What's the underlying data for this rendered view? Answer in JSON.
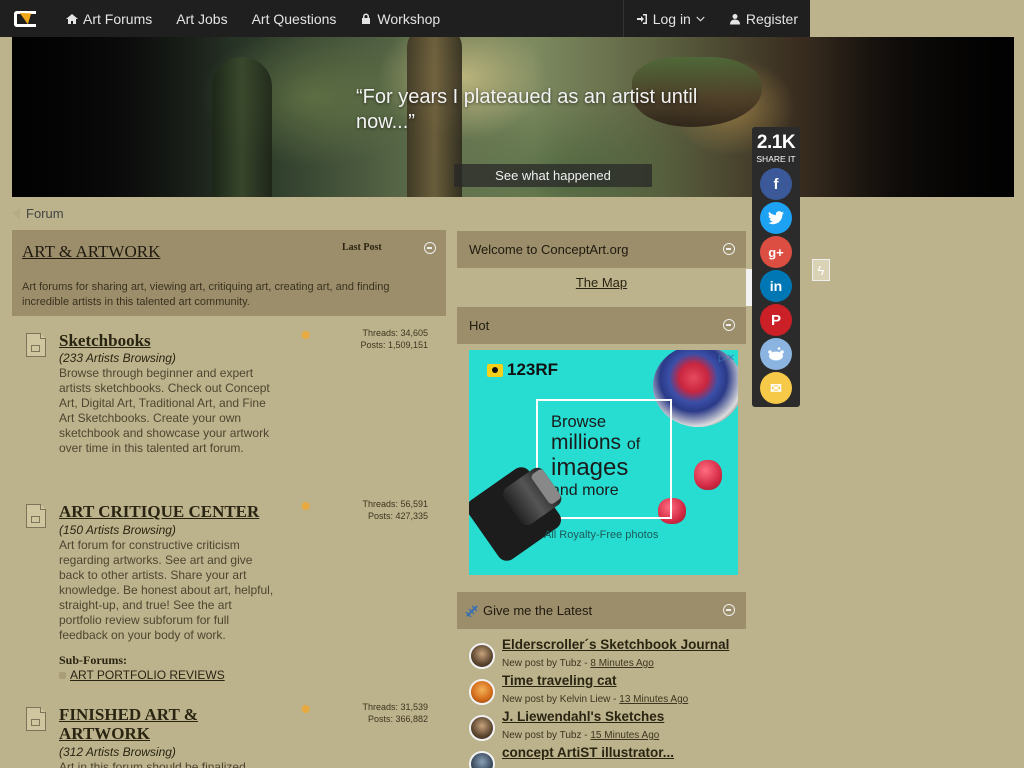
{
  "nav": {
    "items": [
      {
        "label": "Art Forums",
        "icon": "home-icon"
      },
      {
        "label": "Art Jobs"
      },
      {
        "label": "Art Questions"
      },
      {
        "label": "Workshop",
        "icon": "lock-icon"
      }
    ],
    "login": "Log in",
    "register": "Register"
  },
  "banner": {
    "quote": "“For years I  plateaued as an artist until now...”",
    "button": "See what happened"
  },
  "share": {
    "count": "2.1K",
    "label": "SHARE IT",
    "buttons": [
      {
        "name": "facebook",
        "color": "#3b5998",
        "glyph": "f"
      },
      {
        "name": "twitter",
        "color": "#1da1f2",
        "glyph": "t"
      },
      {
        "name": "google-plus",
        "color": "#dc4e41",
        "glyph": "g+"
      },
      {
        "name": "linkedin",
        "color": "#0077b5",
        "glyph": "in"
      },
      {
        "name": "pinterest",
        "color": "#cb2027",
        "glyph": "P"
      },
      {
        "name": "reddit",
        "color": "#8cb4e1",
        "glyph": "r"
      },
      {
        "name": "email",
        "color": "#f6c948",
        "glyph": "✉"
      }
    ]
  },
  "breadcrumb": {
    "label": "Forum"
  },
  "forum": {
    "title": "ART & ARTWORK",
    "last_post": "Last Post",
    "description": "Art forums for sharing art, viewing art, critiquing art, creating art, and finding incredible artists in this talented art community.",
    "items": [
      {
        "title": "Sketchbooks",
        "browsing": "(233 Artists Browsing)",
        "description": "Browse through beginner and expert artists sketchbooks. Check out Concept Art, Digital Art, Traditional Art, and Fine Art Sketchbooks. Create your own sketchbook and showcase your artwork over time in this talented art forum.",
        "threads": "Threads: 34,605",
        "posts": "Posts: 1,509,151"
      },
      {
        "title": "ART CRITIQUE CENTER",
        "browsing": "(150 Artists Browsing)",
        "description": "Art forum for constructive criticism regarding artworks. See art and give back to other artists. Share your art knowledge. Be honest about art, helpful, straight-up, and true! See the art portfolio review subforum for full feedback on your body of work.",
        "threads": "Threads: 56,591",
        "posts": "Posts: 427,335",
        "subforums_label": "Sub-Forums:",
        "subforum": "ART PORTFOLIO REVIEWS"
      },
      {
        "title": "FINISHED ART & ARTWORK",
        "browsing": "(312 Artists Browsing)",
        "description": "Art in this forum should be finalized",
        "threads": "Threads: 31,539",
        "posts": "Posts: 366,882"
      }
    ]
  },
  "welcome": {
    "title": "Welcome to ConceptArt.org",
    "link": "The Map"
  },
  "hot": {
    "title": "Hot"
  },
  "ad": {
    "brand": "123RF",
    "line1": "Browse",
    "line2": "millions",
    "line2b": "of",
    "line3": "images",
    "line4": "and more",
    "footer": "All Royalty-Free photos",
    "close": "▷✕"
  },
  "latest": {
    "title": "Give me the Latest",
    "posts": [
      {
        "title": "Elderscroller´s Sketchbook Journal",
        "by": "New post by Tubz - ",
        "time": "8 Minutes Ago"
      },
      {
        "title": "Time traveling cat",
        "by": "New post by Kelvin Liew - ",
        "time": "13 Minutes Ago"
      },
      {
        "title": "J. Liewendahl's Sketches",
        "by": "New post by Tubz - ",
        "time": "15 Minutes Ago"
      },
      {
        "title": "concept ArtiST illustrator...",
        "by": "",
        "time": ""
      }
    ]
  }
}
